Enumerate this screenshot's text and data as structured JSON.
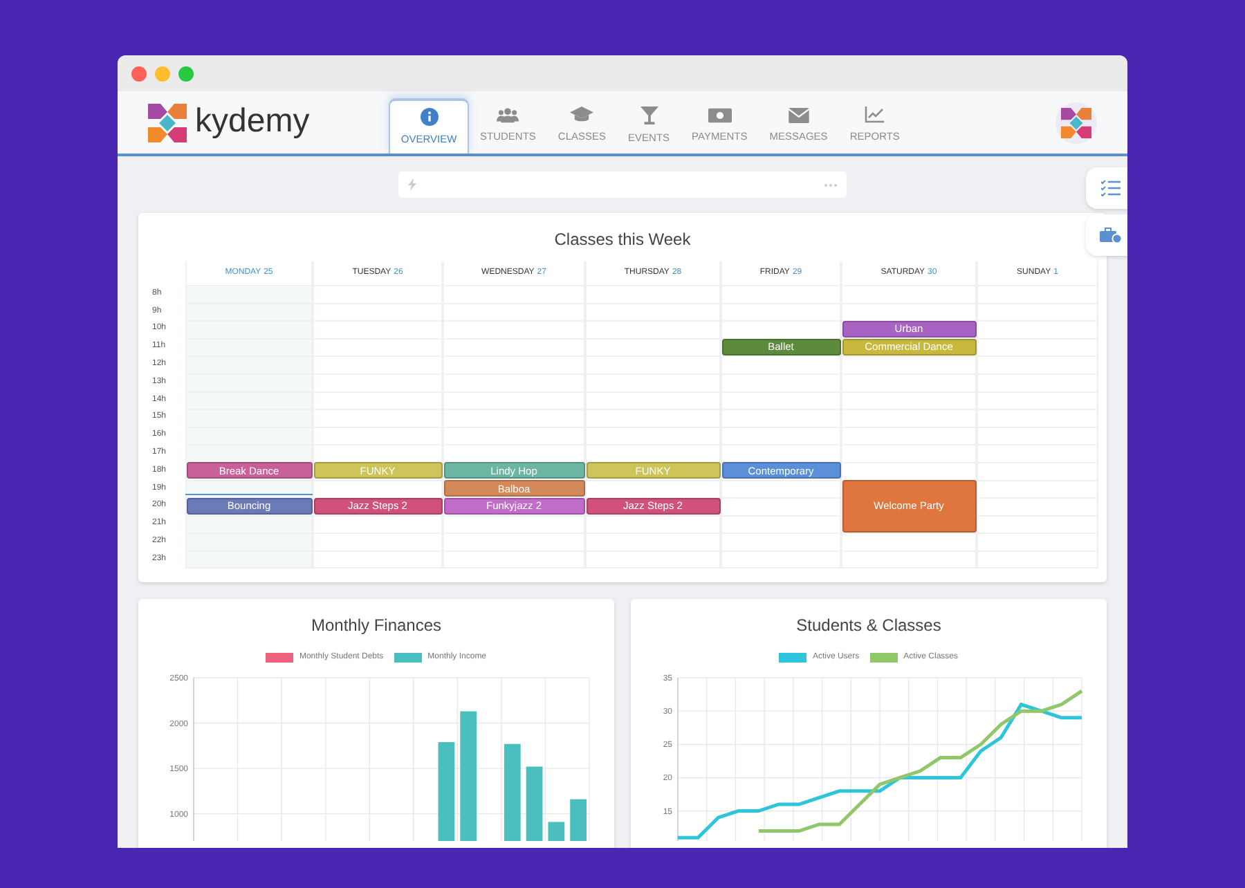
{
  "brand": {
    "name": "kydemy"
  },
  "nav": [
    {
      "label": "OVERVIEW",
      "kind": "info",
      "selected": true
    },
    {
      "label": "STUDENTS",
      "kind": "users",
      "selected": false
    },
    {
      "label": "CLASSES",
      "kind": "cap",
      "selected": false
    },
    {
      "label": "EVENTS",
      "kind": "glass",
      "selected": false
    },
    {
      "label": "PAYMENTS",
      "kind": "money",
      "selected": false
    },
    {
      "label": "MESSAGES",
      "kind": "mail",
      "selected": false
    },
    {
      "label": "REPORTS",
      "kind": "chart",
      "selected": false
    }
  ],
  "calendar": {
    "title": "Classes this Week",
    "time_marker": true,
    "days": [
      {
        "name": "MONDAY",
        "date": "25",
        "today": true
      },
      {
        "name": "TUESDAY",
        "date": "26",
        "today": false
      },
      {
        "name": "WEDNESDAY",
        "date": "27",
        "today": false
      },
      {
        "name": "THURSDAY",
        "date": "28",
        "today": false
      },
      {
        "name": "FRIDAY",
        "date": "29",
        "today": false
      },
      {
        "name": "SATURDAY",
        "date": "30",
        "today": false
      },
      {
        "name": "SUNDAY",
        "date": "1",
        "today": false
      }
    ],
    "rows": [
      {
        "hour": "8h"
      },
      {
        "hour": "9h"
      },
      {
        "hour": "10h",
        "cells": [
          {
            "kind": "empty"
          },
          {
            "kind": "empty"
          },
          {
            "kind": "empty"
          },
          {
            "kind": "empty"
          },
          {
            "kind": "empty"
          },
          {
            "kind": "event",
            "title": "Urban",
            "color": "#a863c4"
          },
          {
            "kind": "empty"
          }
        ]
      },
      {
        "hour": "11h",
        "cells": [
          {
            "kind": "empty"
          },
          {
            "kind": "empty"
          },
          {
            "kind": "empty"
          },
          {
            "kind": "empty"
          },
          {
            "kind": "event",
            "title": "Ballet",
            "color": "#5e8a3e"
          },
          {
            "kind": "event",
            "title": "Commercial Dance",
            "color": "#c9b83e"
          },
          {
            "kind": "empty"
          }
        ]
      },
      {
        "hour": "12h"
      },
      {
        "hour": "13h"
      },
      {
        "hour": "14h"
      },
      {
        "hour": "15h"
      },
      {
        "hour": "16h"
      },
      {
        "hour": "17h"
      },
      {
        "hour": "18h",
        "cells": [
          {
            "kind": "event",
            "title": "Break Dance",
            "color": "#c9609a"
          },
          {
            "kind": "event",
            "title": "FUNKY",
            "color": "#cdc45a"
          },
          {
            "kind": "event",
            "title": "Lindy Hop",
            "color": "#6db5a3"
          },
          {
            "kind": "event",
            "title": "FUNKY",
            "color": "#cdc45a"
          },
          {
            "kind": "event",
            "title": "Contemporary",
            "color": "#5b90d8"
          },
          {
            "kind": "empty"
          },
          {
            "kind": "empty"
          }
        ]
      },
      {
        "hour": "19h",
        "cells": [
          {
            "kind": "empty"
          },
          {
            "kind": "empty"
          },
          {
            "kind": "event",
            "title": "Balboa",
            "color": "#d4895a"
          },
          {
            "kind": "empty"
          },
          {
            "kind": "empty"
          },
          {
            "kind": "long_event",
            "title": "Welcome Party",
            "color": "#e0763f"
          },
          {
            "kind": "empty"
          }
        ]
      },
      {
        "hour": "20h",
        "cells": [
          {
            "kind": "event",
            "title": "Bouncing",
            "color": "#6b7ab8"
          },
          {
            "kind": "event",
            "title": "Jazz Steps 2",
            "color": "#d0517b"
          },
          {
            "kind": "event",
            "title": "Funkyjazz 2",
            "color": "#c26cc9"
          },
          {
            "kind": "event",
            "title": "Jazz Steps 2",
            "color": "#d0517b"
          },
          {
            "kind": "empty"
          },
          {
            "kind": "empty"
          },
          {
            "kind": "empty"
          }
        ]
      },
      {
        "hour": "21h"
      },
      {
        "hour": "22h"
      },
      {
        "hour": "23h"
      }
    ]
  },
  "finances": {
    "title": "Monthly Finances",
    "chart_data": {
      "type": "bar",
      "legend": "top",
      "grid": true,
      "ylim": [
        700,
        2500
      ],
      "yticks": [
        1000,
        1500,
        2000,
        2500
      ],
      "series": [
        {
          "name": "Monthly Student Debts",
          "color": "#f0607f",
          "values": [
            null,
            null,
            null,
            null,
            null,
            null,
            null,
            null,
            null,
            null,
            null,
            null,
            null,
            null,
            null,
            null,
            null,
            null
          ]
        },
        {
          "name": "Monthly Income",
          "color": "#4bbfbf",
          "values": [
            null,
            null,
            null,
            null,
            null,
            null,
            null,
            null,
            null,
            null,
            null,
            1790,
            2130,
            null,
            1770,
            1520,
            910,
            1160
          ]
        }
      ]
    }
  },
  "students": {
    "title": "Students & Classes",
    "chart_data": {
      "type": "line",
      "legend": "top",
      "grid": true,
      "ylim": [
        10.5,
        35
      ],
      "yticks": [
        15,
        20,
        25,
        30,
        35
      ],
      "categories": [
        null,
        null,
        null,
        null,
        null,
        null,
        null,
        null,
        null,
        null,
        null,
        null,
        null,
        null,
        null,
        null,
        null,
        null,
        null,
        null,
        null
      ],
      "series": [
        {
          "name": "Active Users",
          "color": "#2ec4dc",
          "values": [
            11,
            11,
            14,
            15,
            15,
            16,
            16,
            17,
            18,
            18,
            18,
            20,
            20,
            20,
            20,
            24,
            26,
            31,
            30,
            29,
            29
          ]
        },
        {
          "name": "Active Classes",
          "color": "#8fc76a",
          "values": [
            null,
            null,
            null,
            null,
            12,
            12,
            12,
            13,
            13,
            16,
            19,
            20,
            21,
            23,
            23,
            25,
            28,
            30,
            30,
            31,
            33
          ]
        }
      ]
    }
  }
}
